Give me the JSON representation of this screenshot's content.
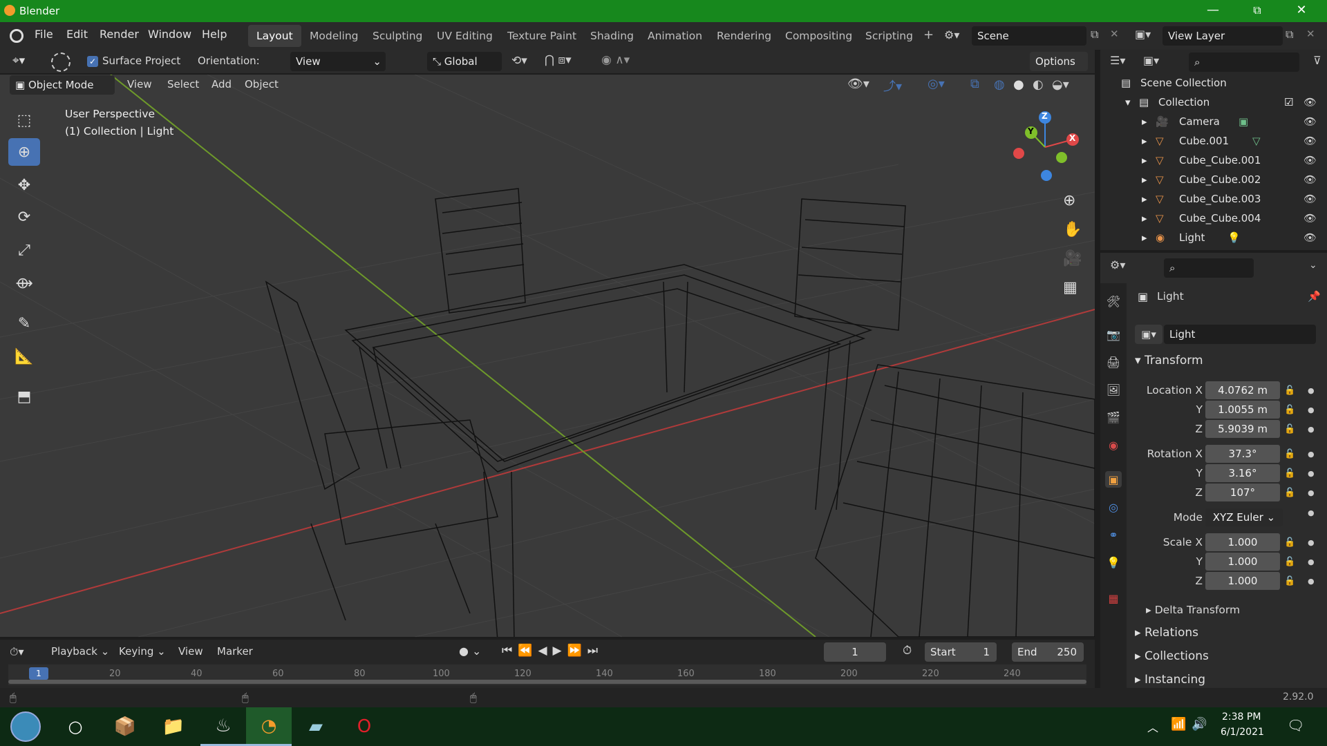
{
  "window": {
    "title": "Blender",
    "minimize": "—",
    "maximize": "⧉",
    "close": "✕"
  },
  "menus": [
    "File",
    "Edit",
    "Render",
    "Window",
    "Help"
  ],
  "workspaces": [
    "Layout",
    "Modeling",
    "Sculpting",
    "UV Editing",
    "Texture Paint",
    "Shading",
    "Animation",
    "Rendering",
    "Compositing",
    "Scripting"
  ],
  "add_workspace": "+",
  "scene": {
    "name": "Scene",
    "view_layer": "View Layer"
  },
  "tool_header": {
    "surface_project": "Surface Project",
    "orientation_label": "Orientation:",
    "orientation_value": "View",
    "transform_orientation": "Global",
    "options": "Options"
  },
  "viewport_header": {
    "mode": "Object Mode",
    "items": [
      "View",
      "Select",
      "Add",
      "Object"
    ]
  },
  "viewport": {
    "perspective": "User Perspective",
    "collection_info": "(1) Collection | Light"
  },
  "gizmo": {
    "x": "X",
    "y": "Y",
    "z": "Z"
  },
  "outliner": {
    "root": "Scene Collection",
    "collection": "Collection",
    "items": [
      "Camera",
      "Cube.001",
      "Cube_Cube.001",
      "Cube_Cube.002",
      "Cube_Cube.003",
      "Cube_Cube.004",
      "Light"
    ]
  },
  "properties": {
    "object_name": "Light",
    "datablock": "Light",
    "transform": "Transform",
    "location_x_label": "Location X",
    "location_x": "4.0762 m",
    "location_y_label": "Y",
    "location_y": "1.0055 m",
    "location_z_label": "Z",
    "location_z": "5.9039 m",
    "rotation_x_label": "Rotation X",
    "rotation_x": "37.3°",
    "rotation_y_label": "Y",
    "rotation_y": "3.16°",
    "rotation_z_label": "Z",
    "rotation_z": "107°",
    "mode_label": "Mode",
    "mode_value": "XYZ Euler",
    "scale_x_label": "Scale X",
    "scale_x": "1.000",
    "scale_y_label": "Y",
    "scale_y": "1.000",
    "scale_z_label": "Z",
    "scale_z": "1.000",
    "delta_transform": "Delta Transform",
    "relations": "Relations",
    "collections": "Collections",
    "instancing": "Instancing"
  },
  "timeline": {
    "menus": [
      "Playback",
      "Keying",
      "View",
      "Marker"
    ],
    "current_frame": "1",
    "start_label": "Start",
    "start": "1",
    "end_label": "End",
    "end": "250",
    "ruler": [
      "1",
      "20",
      "40",
      "60",
      "80",
      "100",
      "120",
      "140",
      "160",
      "180",
      "200",
      "220",
      "240"
    ]
  },
  "status": {
    "version": "2.92.0"
  },
  "taskbar": {
    "time": "2:38 PM",
    "date": "6/1/2021"
  },
  "colors": {
    "title_bar": "#17881d",
    "active_tool": "#4772b3",
    "background": "#3a3a3a",
    "axis_x": "#e04848",
    "axis_y": "#7fbf2a",
    "axis_z": "#3d86e0"
  }
}
